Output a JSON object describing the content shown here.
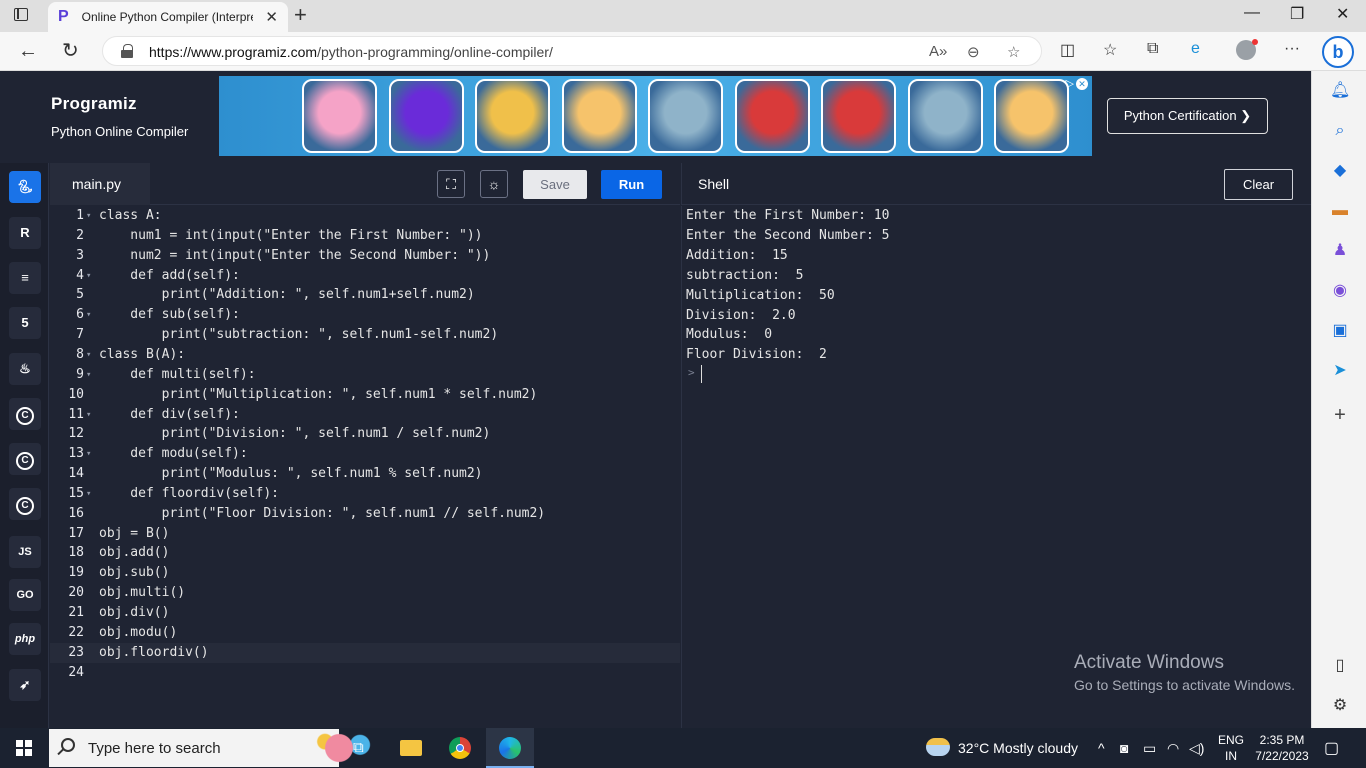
{
  "browser": {
    "tab_title": "Online Python Compiler (Interpre",
    "url_host": "https://www.programiz.com",
    "url_path": "/python-programming/online-compiler/"
  },
  "header": {
    "logo": "Programiz",
    "subtitle": "Python Online Compiler",
    "cert_button": "Python Certification ❯"
  },
  "ad": {
    "tile_colors": [
      "#f5a3c7",
      "#6a2bd9",
      "#f0c04a",
      "#f6c36b",
      "#8fb3c9",
      "#d93a3a",
      "#d93a3a",
      "#8fb3c9",
      "#f6c36b"
    ]
  },
  "languages": [
    "Python",
    "R",
    "SQL",
    "HTML",
    "Java",
    "C",
    "C++",
    "C#",
    "JS",
    "GO",
    "php",
    "Swift"
  ],
  "editor": {
    "file_name": "main.py",
    "save_label": "Save",
    "run_label": "Run",
    "active_line": 23,
    "lines": [
      "class A:",
      "    num1 = int(input(\"Enter the First Number: \"))",
      "    num2 = int(input(\"Enter the Second Number: \"))",
      "    def add(self):",
      "        print(\"Addition: \", self.num1+self.num2)",
      "    def sub(self):",
      "        print(\"subtraction: \", self.num1-self.num2)",
      "class B(A):",
      "    def multi(self):",
      "        print(\"Multiplication: \", self.num1 * self.num2)",
      "    def div(self):",
      "        print(\"Division: \", self.num1 / self.num2)",
      "    def modu(self):",
      "        print(\"Modulus: \", self.num1 % self.num2)",
      "    def floordiv(self):",
      "        print(\"Floor Division: \", self.num1 // self.num2)",
      "obj = B()",
      "obj.add()",
      "obj.sub()",
      "obj.multi()",
      "obj.div()",
      "obj.modu()",
      "obj.floordiv()",
      ""
    ],
    "fold_lines": [
      1,
      4,
      6,
      8,
      9,
      11,
      13,
      15
    ]
  },
  "shell": {
    "title": "Shell",
    "clear_label": "Clear",
    "output": [
      "Enter the First Number: 10",
      "Enter the Second Number: 5",
      "Addition:  15",
      "subtraction:  5",
      "Multiplication:  50",
      "Division:  2.0",
      "Modulus:  0",
      "Floor Division:  2"
    ],
    "prompt": ">"
  },
  "watermark": {
    "line1": "Activate Windows",
    "line2": "Go to Settings to activate Windows."
  },
  "taskbar": {
    "search_placeholder": "Type here to search",
    "weather": "32°C  Mostly cloudy",
    "lang_top": "ENG",
    "lang_bottom": "IN",
    "time": "2:35 PM",
    "date": "7/22/2023"
  }
}
